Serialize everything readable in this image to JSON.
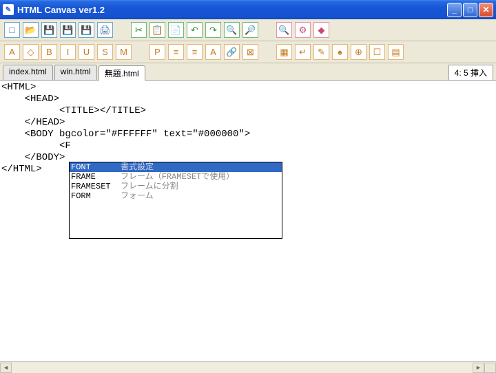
{
  "title": "HTML Canvas  ver1.2",
  "toolbar1": [
    {
      "icon": "□",
      "cls": "b-blue"
    },
    {
      "icon": "📂",
      "cls": "b-blue"
    },
    {
      "icon": "💾",
      "cls": "b-blue"
    },
    {
      "icon": "💾",
      "cls": "b-blue"
    },
    {
      "icon": "💾",
      "cls": "b-blue"
    },
    {
      "icon": "🖨",
      "cls": "b-blue"
    },
    {
      "icon": "",
      "cls": "gap"
    },
    {
      "icon": "✂",
      "cls": "b-green"
    },
    {
      "icon": "📋",
      "cls": "b-green"
    },
    {
      "icon": "📄",
      "cls": "b-green"
    },
    {
      "icon": "↶",
      "cls": "b-green"
    },
    {
      "icon": "↷",
      "cls": "b-green"
    },
    {
      "icon": "🔍",
      "cls": "b-green"
    },
    {
      "icon": "🔎",
      "cls": "b-green"
    },
    {
      "icon": "",
      "cls": "gap"
    },
    {
      "icon": "🔍",
      "cls": "b-pink"
    },
    {
      "icon": "⚙",
      "cls": "b-pink"
    },
    {
      "icon": "◆",
      "cls": "b-pink"
    }
  ],
  "toolbar2": [
    {
      "icon": "A",
      "cls": "b-orange"
    },
    {
      "icon": "◇",
      "cls": "b-orange"
    },
    {
      "icon": "B",
      "cls": "b-orange"
    },
    {
      "icon": "I",
      "cls": "b-orange"
    },
    {
      "icon": "U",
      "cls": "b-orange"
    },
    {
      "icon": "S",
      "cls": "b-orange"
    },
    {
      "icon": "M",
      "cls": "b-orange"
    },
    {
      "icon": "",
      "cls": "gap"
    },
    {
      "icon": "P",
      "cls": "b-orange"
    },
    {
      "icon": "≡",
      "cls": "b-orange"
    },
    {
      "icon": "≡",
      "cls": "b-orange"
    },
    {
      "icon": "A",
      "cls": "b-orange"
    },
    {
      "icon": "🔗",
      "cls": "b-orange"
    },
    {
      "icon": "⊠",
      "cls": "b-orange"
    },
    {
      "icon": "",
      "cls": "gap"
    },
    {
      "icon": "▦",
      "cls": "b-orange"
    },
    {
      "icon": "↵",
      "cls": "b-orange"
    },
    {
      "icon": "✎",
      "cls": "b-orange"
    },
    {
      "icon": "♠",
      "cls": "b-orange"
    },
    {
      "icon": "⊕",
      "cls": "b-orange"
    },
    {
      "icon": "☐",
      "cls": "b-orange"
    },
    {
      "icon": "▤",
      "cls": "b-orange"
    }
  ],
  "tabs": [
    {
      "label": "index.html",
      "active": false
    },
    {
      "label": "win.html",
      "active": false
    },
    {
      "label": "無題.html",
      "active": true
    }
  ],
  "status": "4:  5  挿入",
  "code_lines": [
    "<HTML>",
    "    <HEAD>",
    "          <TITLE></TITLE>",
    "    </HEAD>",
    "    <BODY bgcolor=\"#FFFFFF\" text=\"#000000\">",
    "          <F",
    "    </BODY>",
    "</HTML>"
  ],
  "autocomplete": [
    {
      "tag": "FONT",
      "desc": "書式設定",
      "sel": true
    },
    {
      "tag": "FRAME",
      "desc": "フレーム（FRAMESETで使用）",
      "sel": false
    },
    {
      "tag": "FRAMESET",
      "desc": "フレームに分割",
      "sel": false
    },
    {
      "tag": "FORM",
      "desc": "フォーム",
      "sel": false
    }
  ]
}
